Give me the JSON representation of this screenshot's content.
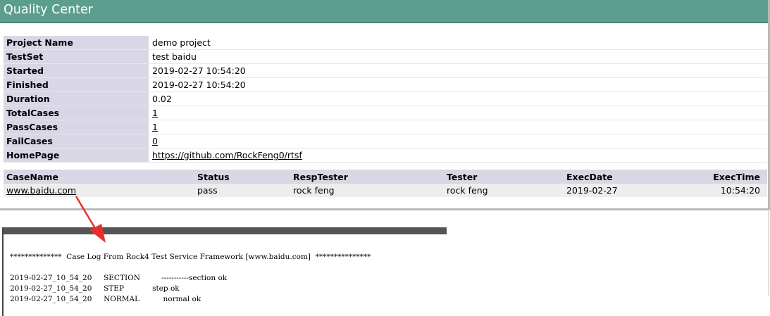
{
  "header": {
    "title": "Quality Center"
  },
  "summary": [
    {
      "label": "Project Name",
      "value": "demo project"
    },
    {
      "label": "TestSet",
      "value": "test baidu"
    },
    {
      "label": "Started",
      "value": "2019-02-27 10:54:20"
    },
    {
      "label": "Finished",
      "value": "2019-02-27 10:54:20"
    },
    {
      "label": "Duration",
      "value": "0.02"
    },
    {
      "label": "TotalCases",
      "value": "1"
    },
    {
      "label": "PassCases",
      "value": "1"
    },
    {
      "label": "FailCases",
      "value": "0"
    },
    {
      "label": "HomePage",
      "value": "https://github.com/RockFeng0/rtsf"
    }
  ],
  "cases": {
    "columns": [
      "CaseName",
      "Status",
      "RespTester",
      "Tester",
      "ExecDate",
      "ExecTime"
    ],
    "rows": [
      {
        "case_name": "www.baidu.com",
        "status": "pass",
        "resp_tester": "rock feng",
        "tester": "rock feng",
        "exec_date": "2019-02-27",
        "exec_time": "10:54:20"
      }
    ]
  },
  "log": {
    "title_line": "**************  Case Log From Rock4 Test Service Framework [www.baidu.com]  ***************",
    "entries": [
      {
        "time": "2019-02-27_10_54_20",
        "level": "SECTION",
        "message": "-----------section ok"
      },
      {
        "time": "2019-02-27_10_54_20",
        "level": "STEP",
        "message": "step ok"
      },
      {
        "time": "2019-02-27_10_54_20",
        "level": "NORMAL",
        "message": "normal ok"
      }
    ]
  },
  "colors": {
    "header": "#5c9e8e",
    "label_bg": "#d9d6e5",
    "arrow": "#e8302a"
  }
}
